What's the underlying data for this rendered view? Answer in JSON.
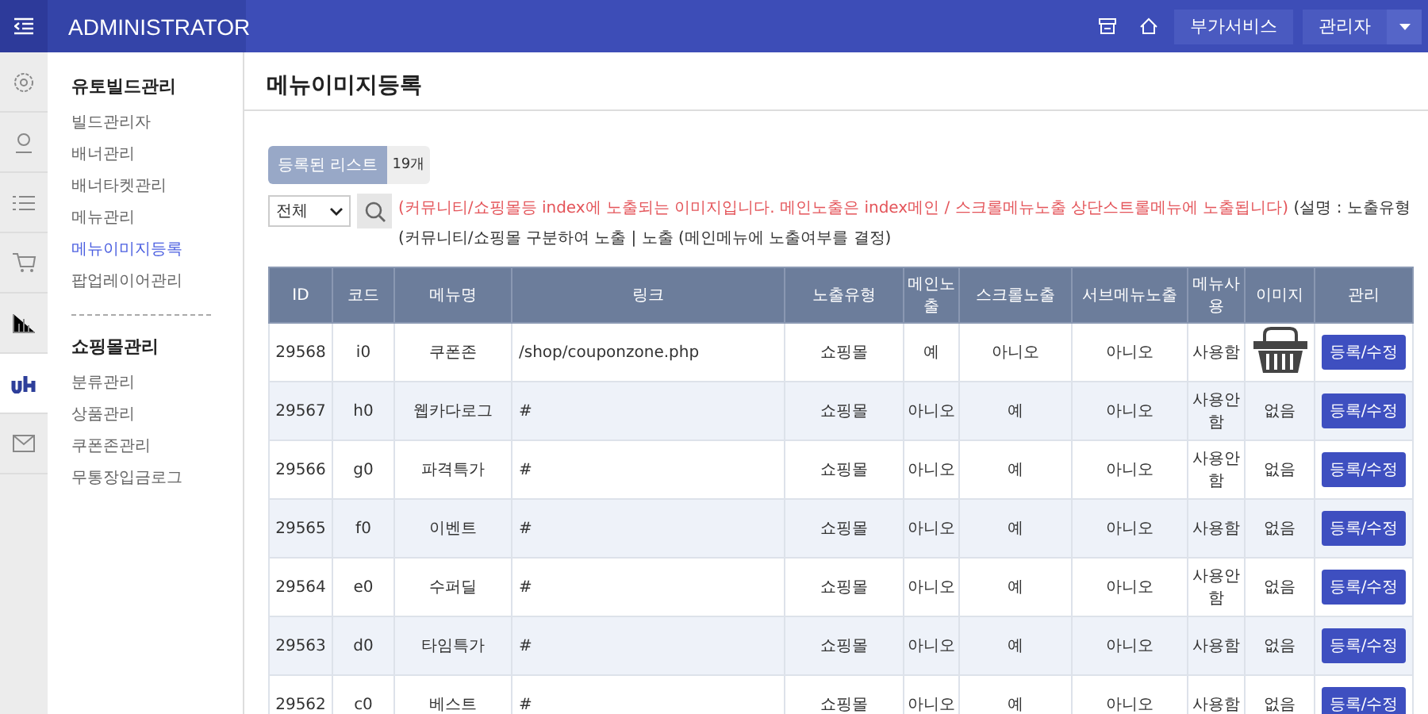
{
  "topbar": {
    "title": "ADMINISTRATOR",
    "buttons": [
      "부가서비스",
      "관리자"
    ]
  },
  "iconbar": [
    {
      "kind": "gear",
      "selected": false
    },
    {
      "kind": "user",
      "selected": false
    },
    {
      "kind": "list",
      "selected": false
    },
    {
      "kind": "cart",
      "selected": false
    },
    {
      "kind": "chart",
      "selected": false
    },
    {
      "kind": "logo",
      "selected": true
    },
    {
      "kind": "mail",
      "selected": false
    }
  ],
  "sidebar": {
    "groups": [
      {
        "title": "유토빌드관리",
        "items": [
          {
            "label": "빌드관리자",
            "selected": false
          },
          {
            "label": "배너관리",
            "selected": false
          },
          {
            "label": "배너타켓관리",
            "selected": false
          },
          {
            "label": "메뉴관리",
            "selected": false
          },
          {
            "label": "메뉴이미지등록",
            "selected": true
          },
          {
            "label": "팝업레이어관리",
            "selected": false
          }
        ]
      },
      {
        "title": "쇼핑몰관리",
        "items": [
          {
            "label": "분류관리",
            "selected": false
          },
          {
            "label": "상품관리",
            "selected": false
          },
          {
            "label": "쿠폰존관리",
            "selected": false
          },
          {
            "label": "무통장입금로그",
            "selected": false
          }
        ]
      }
    ]
  },
  "page_title": "메뉴이미지등록",
  "list_tab": {
    "label": "등록된 리스트",
    "count": "19개"
  },
  "filter": {
    "value": "전체"
  },
  "notice": {
    "warning": "(커뮤니티/쇼핑몰등 index에 노출되는 이미지입니다. 메인노출은 index메인 / 스크롤메뉴노출 상단스트롤메뉴에 노출됩니다)",
    "description": "(설명 : 노출유형(커뮤니티/쇼핑몰 구분하여 노출 | 노출 (메인메뉴에 노출여부를 결정)"
  },
  "table": {
    "columns": [
      "ID",
      "코드",
      "메뉴명",
      "링크",
      "노출유형",
      "메인노출",
      "스크롤노출",
      "서브메뉴노출",
      "메뉴사용",
      "이미지",
      "관리"
    ],
    "rows": [
      {
        "id": "29568",
        "code": "i0",
        "name": "쿠폰존",
        "link": "/shop/couponzone.php",
        "type": "쇼핑몰",
        "main": "예",
        "scroll": "아니오",
        "sub": "아니오",
        "use": "사용함",
        "image": {
          "kind": "icon"
        },
        "action": "등록/수정"
      },
      {
        "id": "29567",
        "code": "h0",
        "name": "웹카다로그",
        "link": "#",
        "type": "쇼핑몰",
        "main": "아니오",
        "scroll": "예",
        "sub": "아니오",
        "use": "사용안함",
        "image": {
          "kind": "text",
          "text": "없음"
        },
        "action": "등록/수정"
      },
      {
        "id": "29566",
        "code": "g0",
        "name": "파격특가",
        "link": "#",
        "type": "쇼핑몰",
        "main": "아니오",
        "scroll": "예",
        "sub": "아니오",
        "use": "사용안함",
        "image": {
          "kind": "text",
          "text": "없음"
        },
        "action": "등록/수정"
      },
      {
        "id": "29565",
        "code": "f0",
        "name": "이벤트",
        "link": "#",
        "type": "쇼핑몰",
        "main": "아니오",
        "scroll": "예",
        "sub": "아니오",
        "use": "사용함",
        "image": {
          "kind": "text",
          "text": "없음"
        },
        "action": "등록/수정"
      },
      {
        "id": "29564",
        "code": "e0",
        "name": "수퍼딜",
        "link": "#",
        "type": "쇼핑몰",
        "main": "아니오",
        "scroll": "예",
        "sub": "아니오",
        "use": "사용안함",
        "image": {
          "kind": "text",
          "text": "없음"
        },
        "action": "등록/수정"
      },
      {
        "id": "29563",
        "code": "d0",
        "name": "타임특가",
        "link": "#",
        "type": "쇼핑몰",
        "main": "아니오",
        "scroll": "예",
        "sub": "아니오",
        "use": "사용함",
        "image": {
          "kind": "text",
          "text": "없음"
        },
        "action": "등록/수정"
      },
      {
        "id": "29562",
        "code": "c0",
        "name": "베스트",
        "link": "#",
        "type": "쇼핑몰",
        "main": "아니오",
        "scroll": "예",
        "sub": "아니오",
        "use": "사용함",
        "image": {
          "kind": "text",
          "text": "없음"
        },
        "action": "등록/수정"
      }
    ]
  }
}
